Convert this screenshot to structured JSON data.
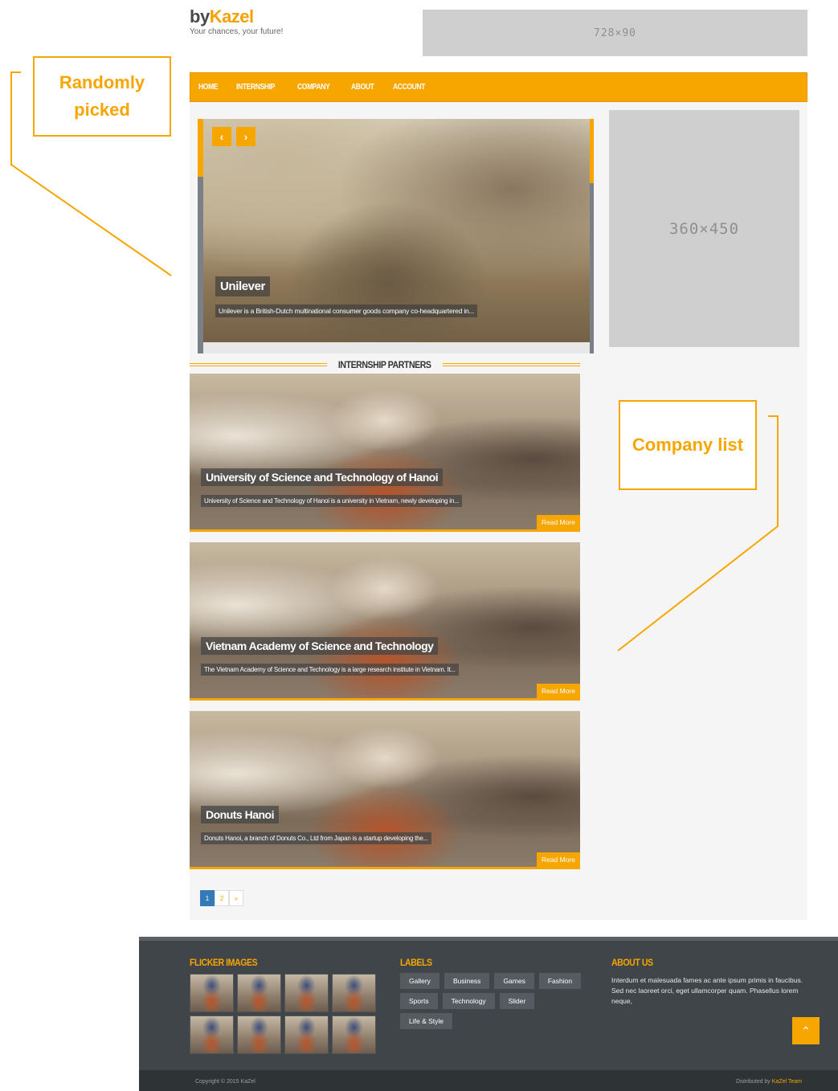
{
  "header": {
    "logo_prefix": "by",
    "logo_brand": "Kazel",
    "tagline": "Your chances, your future!",
    "top_ad": "728×90"
  },
  "nav": {
    "items": [
      "HOME",
      "INTERNSHIP",
      "COMPANY",
      "ABOUT",
      "ACCOUNT"
    ]
  },
  "slider": {
    "prev_icon": "‹",
    "next_icon": "›",
    "title": "Unilever",
    "description": "Unilever is a British-Dutch multinational consumer goods company co-headquartered in..."
  },
  "sidebar": {
    "ad": "360×450"
  },
  "partners": {
    "heading": "INTERNSHIP PARTNERS",
    "read_more_label": "Read More",
    "cards": [
      {
        "title": "University of Science and Technology of Hanoi",
        "description": "University of Science and Technology of Hanoi is a university in Vietnam, newly developing in..."
      },
      {
        "title": "Vietnam Academy of Science and Technology",
        "description": "The Vietnam Academy of Science and Technology is a large research institute in Vietnam. It..."
      },
      {
        "title": "Donuts Hanoi",
        "description": "Donuts Hanoi, a branch of Donuts Co., Ltd from Japan is a startup developing the..."
      }
    ]
  },
  "pagination": {
    "pages": [
      "1",
      "2",
      "»"
    ],
    "active": "1"
  },
  "footer": {
    "flicker_title": "FLICKER IMAGES",
    "labels_title": "LABELS",
    "labels": [
      "Gallery",
      "Business",
      "Games",
      "Fashion",
      "Sports",
      "Technology",
      "Slider",
      "Life & Style"
    ],
    "about_title": "ABOUT US",
    "about_text": "Interdum et malesuada fames ac ante ipsum primis in faucibus. Sed nec laoreet orci, eget ullamcorper quam. Phasellus lorem neque,",
    "back_to_top_icon": "⌃",
    "copyright": "Copyright © 2015 KaZel",
    "distributed_prefix": "Distributed by",
    "distributed_team": "KaZel Team"
  },
  "annotations": {
    "left": "Randomly picked",
    "right": "Company list"
  },
  "colors": {
    "accent": "#f7a600",
    "footer_bg": "#3f4548",
    "page_active": "#337ab7"
  }
}
